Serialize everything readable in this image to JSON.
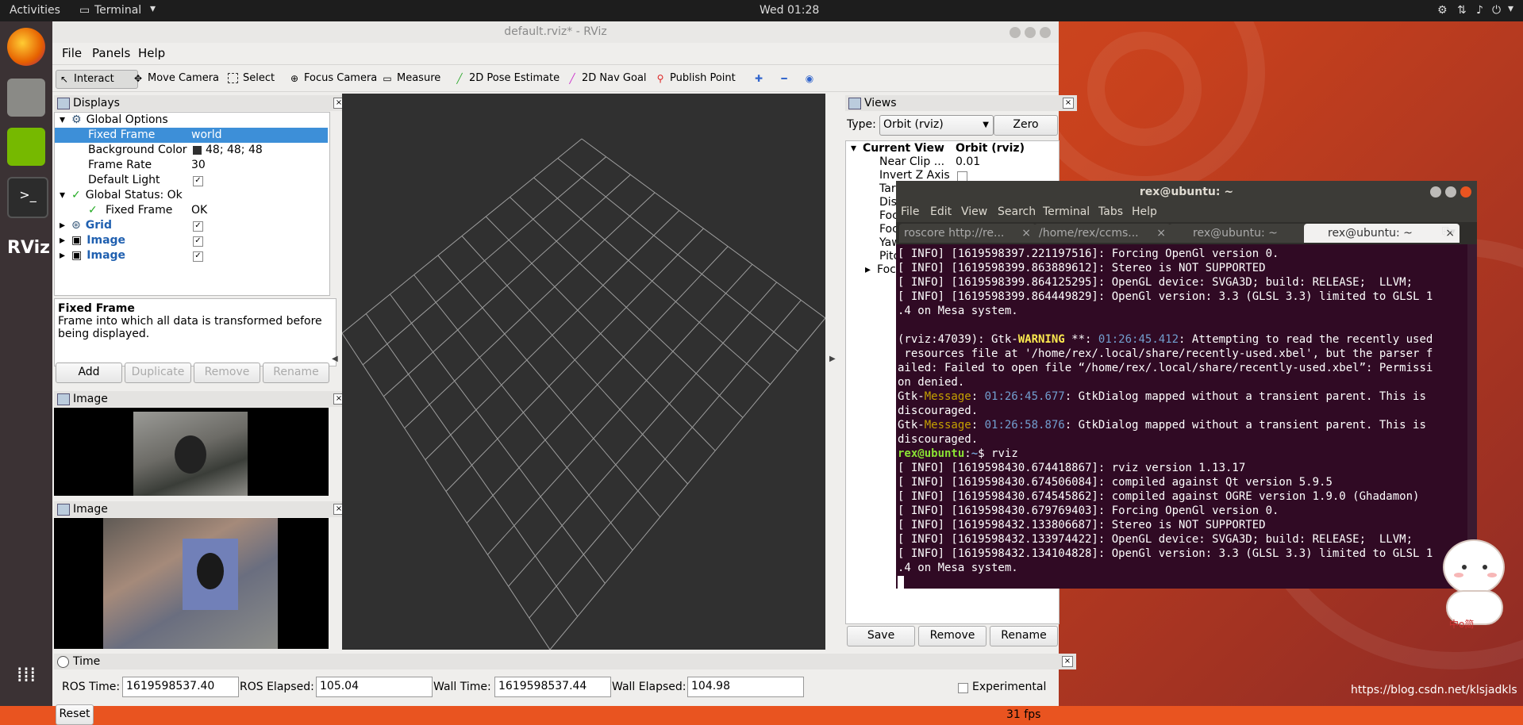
{
  "topbar": {
    "activities": "Activities",
    "app_menu": "Terminal",
    "clock": "Wed 01:28"
  },
  "rviz": {
    "title": "default.rviz* - RViz",
    "menu": [
      "File",
      "Panels",
      "Help"
    ],
    "tools": [
      "Interact",
      "Move Camera",
      "Select",
      "Focus Camera",
      "Measure",
      "2D Pose Estimate",
      "2D Nav Goal",
      "Publish Point"
    ],
    "displays": {
      "header": "Displays",
      "global_options": "Global Options",
      "fixed_frame_label": "Fixed Frame",
      "fixed_frame_value": "world",
      "bg_color_label": "Background Color",
      "bg_color_value": "48; 48; 48",
      "frame_rate_label": "Frame Rate",
      "frame_rate_value": "30",
      "default_light_label": "Default Light",
      "global_status": "Global Status: Ok",
      "status_fixed_frame": "Fixed Frame",
      "status_fixed_frame_value": "OK",
      "grid": "Grid",
      "image1": "Image",
      "image2": "Image",
      "desc_title": "Fixed Frame",
      "desc_text": "Frame into which all data is transformed before being displayed.",
      "buttons": [
        "Add",
        "Duplicate",
        "Remove",
        "Rename"
      ]
    },
    "image_panel1": "Image",
    "image_panel2": "Image",
    "views": {
      "header": "Views",
      "type_label": "Type:",
      "type_value": "Orbit (rviz)",
      "zero": "Zero",
      "current_view": "Current View",
      "current_view_value": "Orbit (rviz)",
      "near_clip": "Near Clip ...",
      "near_clip_value": "0.01",
      "invert_z": "Invert Z Axis",
      "partial": [
        "Tar",
        "Dis",
        "Foc",
        "Foc",
        "Yaw",
        "Pitc",
        "Foc"
      ],
      "buttons": [
        "Save",
        "Remove",
        "Rename"
      ]
    },
    "time": {
      "header": "Time",
      "ros_time_label": "ROS Time:",
      "ros_time": "1619598537.40",
      "ros_elapsed_label": "ROS Elapsed:",
      "ros_elapsed": "105.04",
      "wall_time_label": "Wall Time:",
      "wall_time": "1619598537.44",
      "wall_elapsed_label": "Wall Elapsed:",
      "wall_elapsed": "104.98",
      "experimental": "Experimental",
      "reset": "Reset",
      "fps": "31 fps"
    }
  },
  "terminal": {
    "title": "rex@ubuntu: ~",
    "menu": [
      "File",
      "Edit",
      "View",
      "Search",
      "Terminal",
      "Tabs",
      "Help"
    ],
    "tabs": [
      "roscore http://re...",
      "/home/rex/ccms...",
      "rex@ubuntu: ~",
      "rex@ubuntu: ~"
    ],
    "lines": [
      "[ INFO] [1619598397.221197516]: Forcing OpenGl version 0.",
      "[ INFO] [1619598399.863889612]: Stereo is NOT SUPPORTED",
      "[ INFO] [1619598399.864125295]: OpenGL device: SVGA3D; build: RELEASE;  LLVM;",
      "[ INFO] [1619598399.864449829]: OpenGl version: 3.3 (GLSL 3.3) limited to GLSL 1",
      ".4 on Mesa system.",
      "",
      "(rviz:47039): Gtk-",
      "WARNING",
      " **: ",
      "01:26:45.412",
      ": Attempting to read the recently used",
      " resources file at '/home/rex/.local/share/recently-used.xbel', but the parser f",
      "ailed: Failed to open file “/home/rex/.local/share/recently-used.xbel”: Permissi",
      "on denied.",
      "Gtk-",
      "Message",
      ": ",
      "01:26:45.677",
      ": GtkDialog mapped without a transient parent. This is",
      "discouraged.",
      "Gtk-",
      "Message",
      ": ",
      "01:26:58.876",
      ": GtkDialog mapped without a transient parent. This is",
      "discouraged.",
      "rex@ubuntu",
      ":",
      "~",
      "$ rviz",
      "[ INFO] [1619598430.674418867]: rviz version 1.13.17",
      "[ INFO] [1619598430.674506084]: compiled against Qt version 5.9.5",
      "[ INFO] [1619598430.674545862]: compiled against OGRE version 1.9.0 (Ghadamon)",
      "[ INFO] [1619598430.679769403]: Forcing OpenGl version 0.",
      "[ INFO] [1619598432.133806687]: Stereo is NOT SUPPORTED",
      "[ INFO] [1619598432.133974422]: OpenGL device: SVGA3D; build: RELEASE;  LLVM;",
      "[ INFO] [1619598432.134104828]: OpenGl version: 3.3 (GLSL 3.3) limited to GLSL 1",
      ".4 on Mesa system."
    ]
  },
  "watermark": "https://blog.csdn.net/klsjadkls",
  "sticker_text": "中ο简"
}
